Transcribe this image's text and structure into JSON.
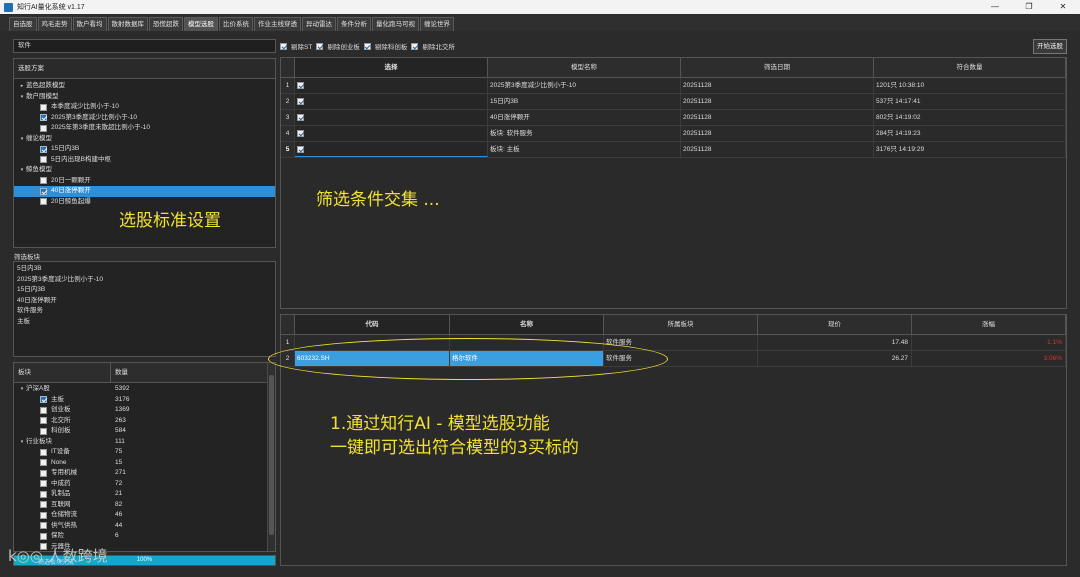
{
  "window": {
    "title": "知行AI量化系统 v1.17",
    "controls": [
      "—",
      "❐",
      "✕"
    ]
  },
  "tabs": [
    "自选股",
    "鸡毛走势",
    "散户看均",
    "散射数据库",
    "恐慌超跌",
    "模型选股",
    "比价系统",
    "作业主线穿透",
    "异动雷达",
    "条件分析",
    "量化跑马可视",
    "缠论世界"
  ],
  "active_tab_index": 5,
  "left": {
    "search_value": "软件",
    "scheme_header": "选股方案",
    "tree": [
      {
        "label": "蓝色超跌模型",
        "level": 0,
        "arrow": "▸",
        "cb": null,
        "selected": false
      },
      {
        "label": "散户囤模型",
        "level": 0,
        "arrow": "▾",
        "cb": null,
        "selected": false
      },
      {
        "label": "本季度减少比例小于-10",
        "level": 1,
        "arrow": "",
        "cb": "off",
        "selected": false
      },
      {
        "label": "2025第3季度减少比例小于-10",
        "level": 1,
        "arrow": "",
        "cb": "on-blue",
        "selected": false
      },
      {
        "label": "2025年第3季度未散超比例小于-10",
        "level": 1,
        "arrow": "",
        "cb": "off",
        "selected": false
      },
      {
        "label": "缠论模型",
        "level": 0,
        "arrow": "▾",
        "cb": null,
        "selected": false
      },
      {
        "label": "15日内3B",
        "level": 1,
        "arrow": "",
        "cb": "on-blue",
        "selected": false
      },
      {
        "label": "5日内出现B构建中枢",
        "level": 1,
        "arrow": "",
        "cb": "off",
        "selected": false
      },
      {
        "label": "鲸鱼模型",
        "level": 0,
        "arrow": "▾",
        "cb": null,
        "selected": false
      },
      {
        "label": "20日一颗颗开",
        "level": 1,
        "arrow": "",
        "cb": "off",
        "selected": false
      },
      {
        "label": "40日涨停颗开",
        "level": 1,
        "arrow": "",
        "cb": "on-blue",
        "selected": true
      },
      {
        "label": "20日鲸鱼起爆",
        "level": 1,
        "arrow": "",
        "cb": "off",
        "selected": false
      }
    ],
    "overlay_standard": "选股标准设置",
    "filter_block_label": "筛选板块",
    "filter_block_lines": [
      "5日内3B",
      "2025第3季度减少比例小于-10",
      "15日内3B",
      "40日涨停颗开",
      "软件服务",
      "主板"
    ],
    "sector_headers": [
      "板块",
      "数量"
    ],
    "sectors": [
      {
        "label": "沪深A股",
        "count": "5392",
        "level": 0,
        "arrow": "▾",
        "cb": null
      },
      {
        "label": "主板",
        "count": "3176",
        "level": 1,
        "arrow": "",
        "cb": "on-blue"
      },
      {
        "label": "创业板",
        "count": "1369",
        "level": 1,
        "arrow": "",
        "cb": "off"
      },
      {
        "label": "北交所",
        "count": "263",
        "level": 1,
        "arrow": "",
        "cb": "off"
      },
      {
        "label": "科创板",
        "count": "584",
        "level": 1,
        "arrow": "",
        "cb": "off"
      },
      {
        "label": "行业板块",
        "count": "111",
        "level": 0,
        "arrow": "▾",
        "cb": null
      },
      {
        "label": "IT设备",
        "count": "75",
        "level": 1,
        "arrow": "",
        "cb": "off"
      },
      {
        "label": "None",
        "count": "15",
        "level": 1,
        "arrow": "",
        "cb": "off"
      },
      {
        "label": "专用机械",
        "count": "271",
        "level": 1,
        "arrow": "",
        "cb": "off"
      },
      {
        "label": "中成药",
        "count": "72",
        "level": 1,
        "arrow": "",
        "cb": "off"
      },
      {
        "label": "乳制品",
        "count": "21",
        "level": 1,
        "arrow": "",
        "cb": "off"
      },
      {
        "label": "互联网",
        "count": "82",
        "level": 1,
        "arrow": "",
        "cb": "off"
      },
      {
        "label": "仓储物流",
        "count": "46",
        "level": 1,
        "arrow": "",
        "cb": "off"
      },
      {
        "label": "供气供热",
        "count": "44",
        "level": 1,
        "arrow": "",
        "cb": "off"
      },
      {
        "label": "保险",
        "count": "6",
        "level": 1,
        "arrow": "",
        "cb": "off"
      },
      {
        "label": "元器件",
        "count": "",
        "level": 1,
        "arrow": "",
        "cb": "off"
      }
    ],
    "progress_text": "100%",
    "progress_fraction": 1.0,
    "status_left": "筛选板块完成"
  },
  "filters": {
    "items": [
      {
        "label": "剔除ST",
        "checked": true
      },
      {
        "label": "剔除创业板",
        "checked": true
      },
      {
        "label": "剔除科创板",
        "checked": true
      },
      {
        "label": "剔除北交所",
        "checked": true
      }
    ],
    "start_button": "开始选股"
  },
  "top_table": {
    "headers": [
      "选择",
      "模型名称",
      "筛选日期",
      "符合数量"
    ],
    "rows": [
      {
        "n": "1",
        "checked": true,
        "name": "2025第3季度减少比例小于-10",
        "date": "20251128",
        "count": "1201只 10:38:10"
      },
      {
        "n": "2",
        "checked": true,
        "name": "15日内3B",
        "date": "20251128",
        "count": "537只 14:17:41"
      },
      {
        "n": "3",
        "checked": true,
        "name": "40日涨停颗开",
        "date": "20251128",
        "count": "802只 14:19:02"
      },
      {
        "n": "4",
        "checked": true,
        "name": "板块: 软件服务",
        "date": "20251128",
        "count": "284只 14:19:23"
      },
      {
        "n": "5",
        "checked": true,
        "name": "板块: 主板",
        "date": "20251128",
        "count": "3176只 14:19:29"
      }
    ],
    "overlay": "筛选条件交集 ..."
  },
  "bottom_table": {
    "headers": [
      "代码",
      "名称",
      "所属板块",
      "现价",
      "涨幅"
    ],
    "rows": [
      {
        "n": "1",
        "code": "",
        "name": "",
        "sector": "软件服务",
        "price": "17.48",
        "change": "1.1%",
        "selected": false
      },
      {
        "n": "2",
        "code": "603232.SH",
        "name": "格尔软件",
        "sector": "软件服务",
        "price": "26.27",
        "change": "3.06%",
        "selected": true
      }
    ],
    "overlay_line1": "1.通过知行AI - 模型选股功能",
    "overlay_line2": "一键即可选出符合模型的3买标的"
  },
  "watermark": "k◎◎ 人数跨境",
  "colors": {
    "accent": "#2f8fd6",
    "overlay": "#f2e230",
    "negative": "#e03030",
    "progress": "#12a8c8"
  }
}
